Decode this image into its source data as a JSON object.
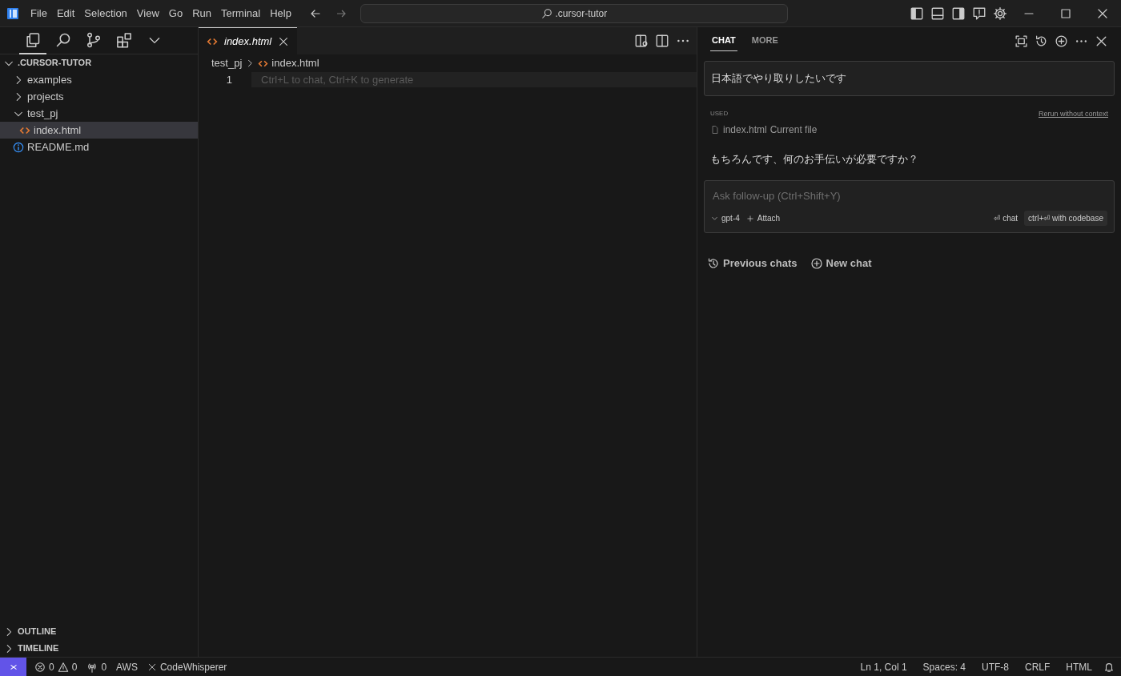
{
  "title_bar": {
    "menu": [
      "File",
      "Edit",
      "Selection",
      "View",
      "Go",
      "Run",
      "Terminal",
      "Help"
    ],
    "search": ".cursor-tutor"
  },
  "activity_bar": [
    {
      "kind": "files",
      "selected": true
    },
    {
      "kind": "search",
      "selected": false
    },
    {
      "kind": "branch",
      "selected": false
    },
    {
      "kind": "extensions",
      "selected": false
    }
  ],
  "explorer": {
    "title": ".CURSOR-TUTOR",
    "expanded": true,
    "items": [
      {
        "label": "examples",
        "kind": "folder",
        "expanded": false,
        "selected": false
      },
      {
        "label": "projects",
        "kind": "folder",
        "expanded": false,
        "selected": false
      },
      {
        "label": "test_pj",
        "kind": "folder",
        "expanded": true,
        "selected": false,
        "children": [
          {
            "label": "index.html",
            "kind": "html",
            "selected": true
          }
        ]
      },
      {
        "label": "README.md",
        "kind": "info",
        "selected": false
      }
    ]
  },
  "sections": [
    {
      "label": "OUTLINE",
      "expanded": false
    },
    {
      "label": "TIMELINE",
      "expanded": false
    }
  ],
  "editor": {
    "tabs": [
      {
        "label": "index.html",
        "selected": true
      }
    ],
    "breadcrumb": [
      "test_pj",
      "index.html"
    ],
    "lines": [
      {
        "number": "1",
        "hint": "Ctrl+L to chat, Ctrl+K to generate"
      }
    ]
  },
  "chat": {
    "tabs": [
      {
        "label": "CHAT",
        "selected": true
      },
      {
        "label": "MORE",
        "selected": false
      }
    ],
    "user_message": "日本語でやり取りしたいです",
    "used_label": "USED",
    "rerun_link": "Rerun without context",
    "context_file": "index.html",
    "context_note": "Current file",
    "reply": "もちろんです、何のお手伝いが必要ですか？",
    "input": {
      "placeholder": "Ask follow-up (Ctrl+Shift+Y)",
      "model": "gpt-4",
      "attach": "Attach",
      "submit": "⏎ chat",
      "submit_codebase": "ctrl+⏎ with codebase"
    },
    "footer": [
      "Previous chats",
      "New chat"
    ]
  },
  "status_bar": {
    "errors": "0",
    "warnings": "0",
    "ports": "0",
    "left": [
      "AWS",
      "CodeWhisperer"
    ],
    "right": [
      "Ln 1, Col 1",
      "Spaces: 4",
      "UTF-8",
      "CRLF",
      "HTML"
    ]
  }
}
